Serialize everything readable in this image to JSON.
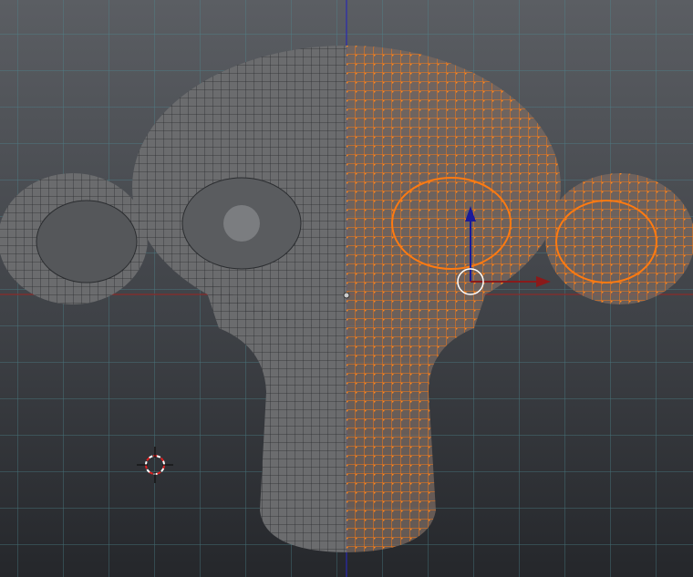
{
  "viewport": {
    "mode": "edit-mode",
    "object": "suzanne-mesh",
    "colors": {
      "background_top": "#5b5e63",
      "background_bottom": "#25272b",
      "grid": "#4e8a93",
      "x_axis": "#8a2a2a",
      "z_axis": "#2a2ab0",
      "selected": "#ff7a10",
      "mesh": "#6a6a6a"
    },
    "icons": {
      "gizmo": "transform-gizmo-icon",
      "cursor": "3d-cursor-icon"
    }
  }
}
